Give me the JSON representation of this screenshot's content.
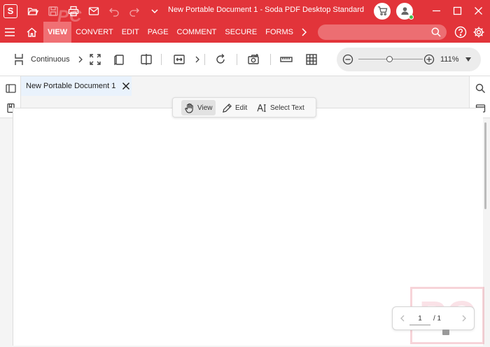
{
  "window": {
    "title": "New Portable Document 1  -  Soda PDF Desktop Standard",
    "logo_letter": "S"
  },
  "ribbon": {
    "tabs": [
      {
        "label": "VIEW",
        "active": true
      },
      {
        "label": "CONVERT",
        "active": false
      },
      {
        "label": "EDIT",
        "active": false
      },
      {
        "label": "PAGE",
        "active": false
      },
      {
        "label": "COMMENT",
        "active": false
      },
      {
        "label": "SECURE",
        "active": false
      },
      {
        "label": "FORMS",
        "active": false
      }
    ],
    "search_placeholder": ""
  },
  "toolbar": {
    "page_layout_label": "Continuous",
    "zoom_level": "111%",
    "zoom_slider_fraction": 0.48
  },
  "document": {
    "tab_label": "New Portable Document 1"
  },
  "mode_bar": {
    "view_label": "View",
    "edit_label": "Edit",
    "select_text_label": "Select Text"
  },
  "page_nav": {
    "current_page": "1",
    "total_pages": "/ 1"
  },
  "watermark": {
    "top_text": "PC",
    "corner_text": "PC"
  },
  "colors": {
    "brand_red": "#e2343a",
    "active_tab": "#f07074",
    "doc_tab_bg": "#e9f2fc"
  }
}
